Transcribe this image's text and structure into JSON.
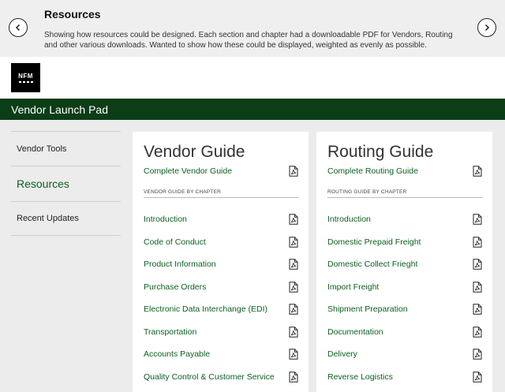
{
  "header": {
    "title": "Resources",
    "description": "Showing how resources could be designed. Each section and chapter had a downloadable PDF for Vendors, Routing and other various downloads. Wanted to show how these could be displayed, weighted as evenly as possible."
  },
  "logo": {
    "text": "NFM"
  },
  "app_bar": {
    "title": "Vendor Launch Pad"
  },
  "sidebar": {
    "items": [
      {
        "label": "Vendor Tools"
      },
      {
        "label": "Resources"
      },
      {
        "label": "Recent Updates"
      }
    ]
  },
  "vendor_guide": {
    "title": "Vendor Guide",
    "complete_label": "Complete Vendor Guide",
    "chapter_heading": "VENDOR GUIDE BY CHAPTER",
    "chapters": [
      {
        "label": "Introduction"
      },
      {
        "label": "Code of Conduct"
      },
      {
        "label": "Product Information"
      },
      {
        "label": "Purchase Orders"
      },
      {
        "label": "Electronic Data Interchange (EDI)"
      },
      {
        "label": "Transportation"
      },
      {
        "label": "Accounts Payable"
      },
      {
        "label": "Quality Control & Customer Service"
      }
    ]
  },
  "routing_guide": {
    "title": "Routing Guide",
    "complete_label": "Complete Routing Guide",
    "chapter_heading": "ROUTING GUIDE BY CHAPTER",
    "chapters": [
      {
        "label": "Introduction"
      },
      {
        "label": "Domestic Prepaid Freight"
      },
      {
        "label": "Domestic Collect Frieght"
      },
      {
        "label": "Import Freight"
      },
      {
        "label": "Shipment Preparation"
      },
      {
        "label": "Documentation"
      },
      {
        "label": "Delivery"
      },
      {
        "label": "Reverse Logistics"
      }
    ]
  },
  "colors": {
    "brand_green": "#0b3d17",
    "link_green": "#0b5f1f"
  },
  "icons": {
    "pdf": "pdf-file-icon",
    "prev": "chevron-left-icon",
    "next": "chevron-right-icon"
  }
}
